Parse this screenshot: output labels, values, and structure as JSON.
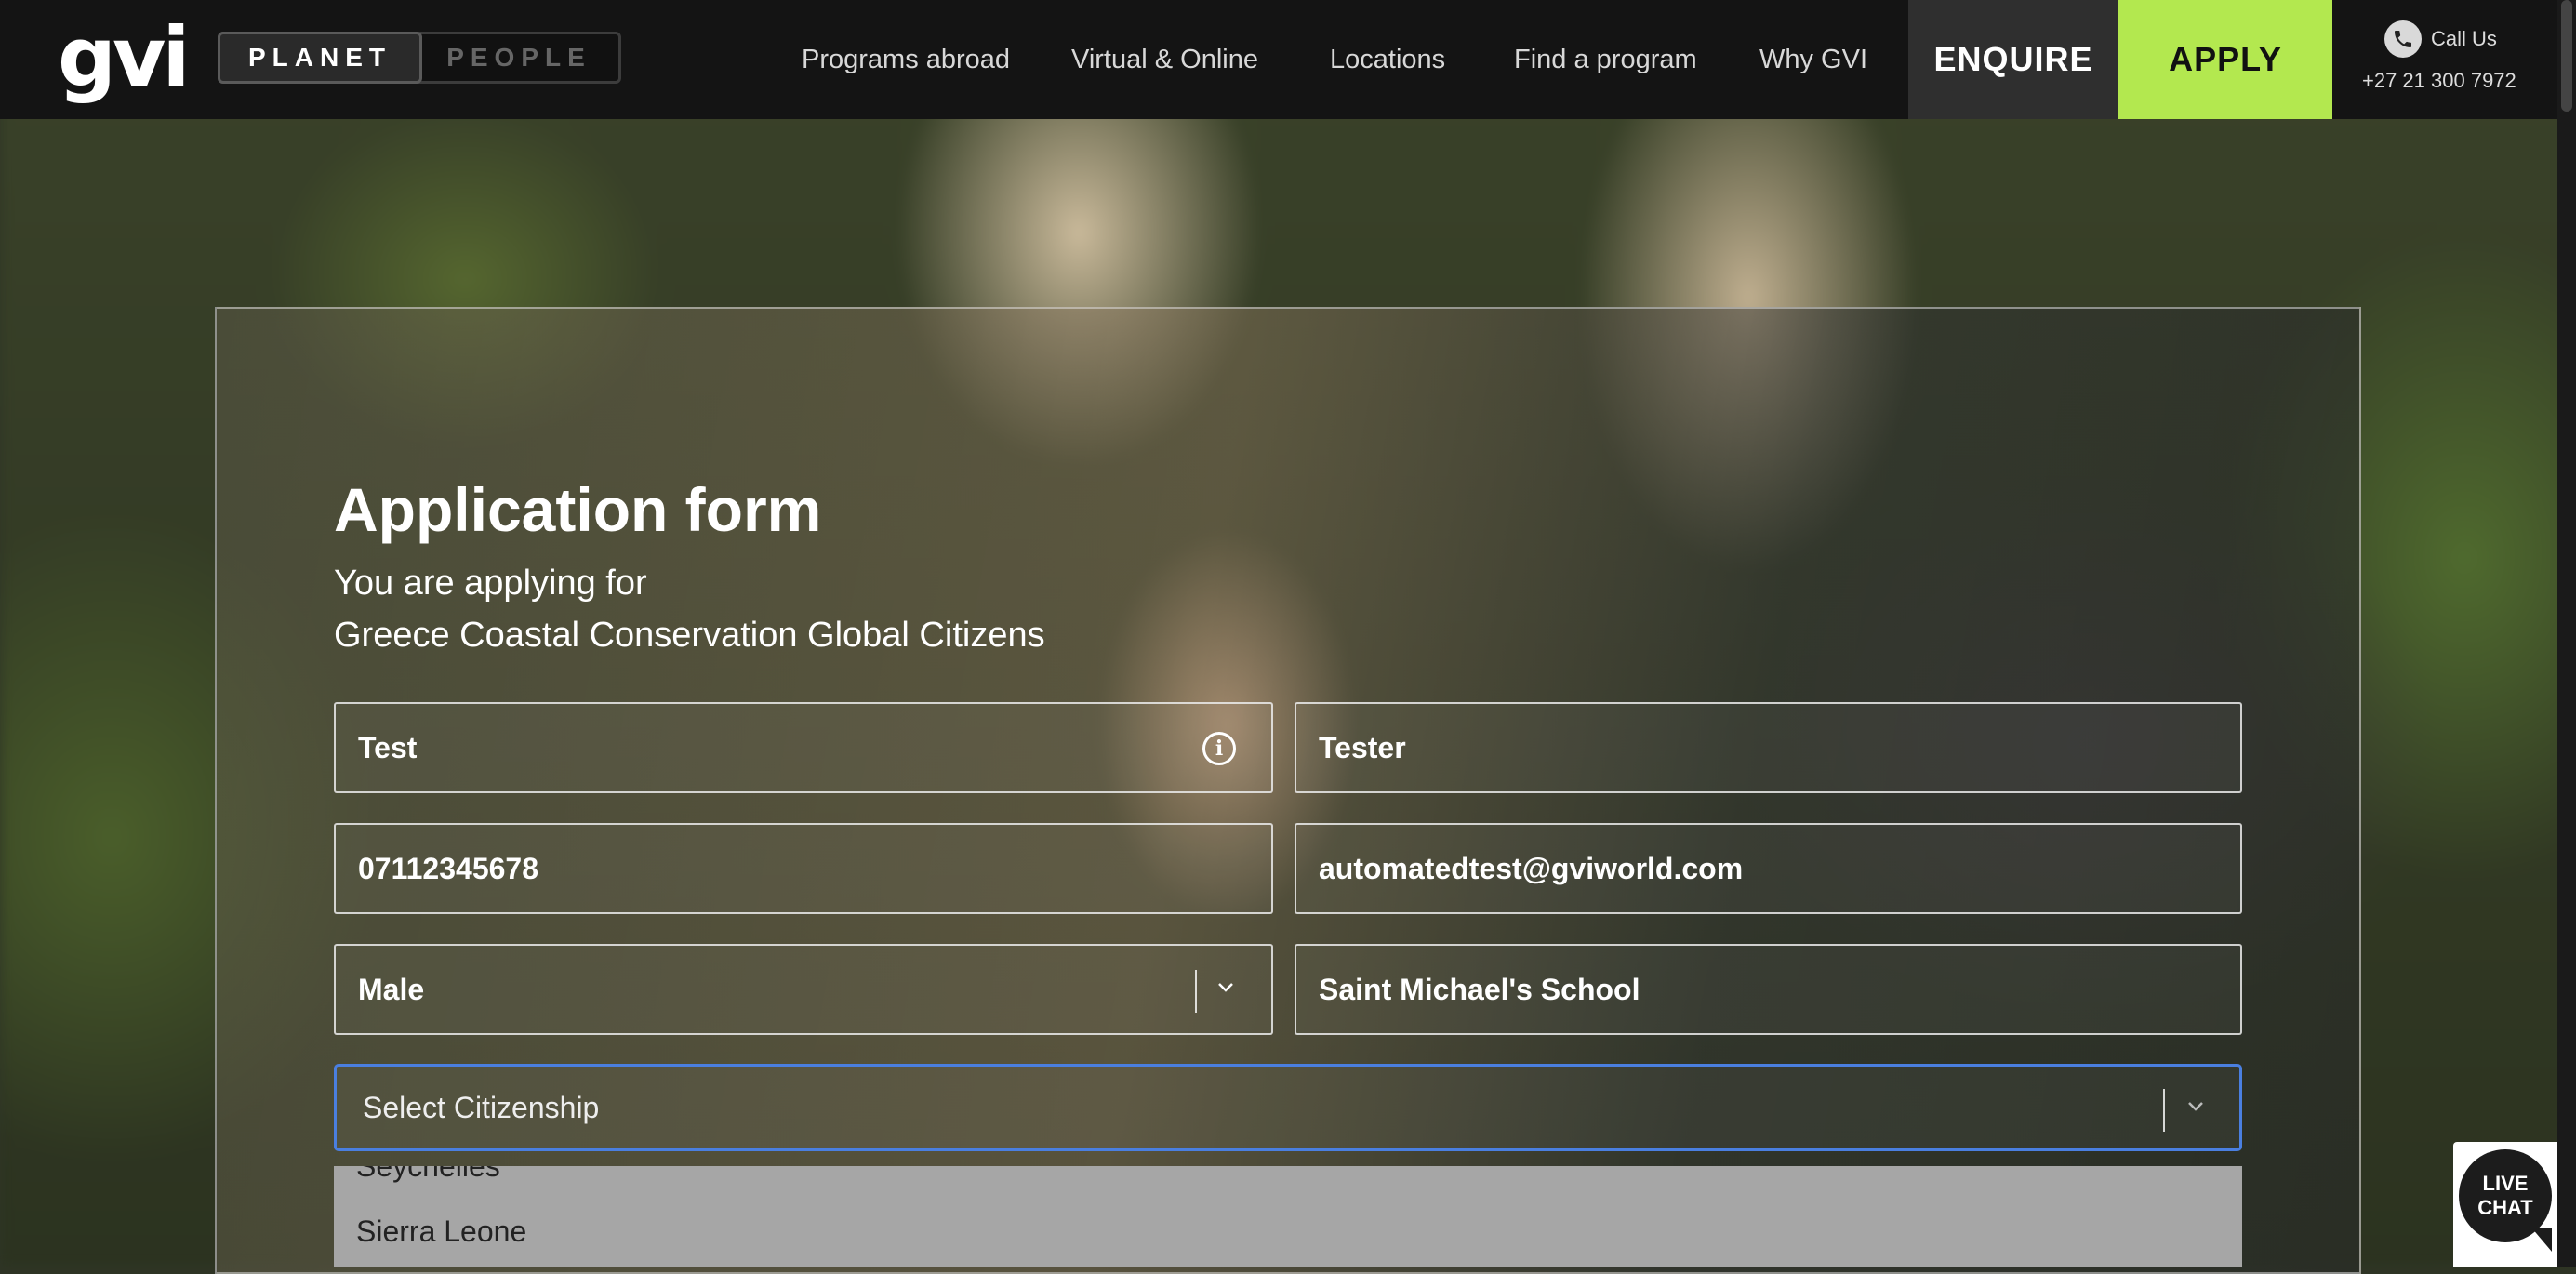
{
  "header": {
    "logo": "gvi",
    "toggle": [
      "PLANET",
      "PEOPLE"
    ],
    "toggle_active": "PLANET",
    "nav": [
      "Programs abroad",
      "Virtual & Online",
      "Locations",
      "Find a program",
      "Why GVI"
    ],
    "enquire": "ENQUIRE",
    "apply": "APPLY",
    "call_label": "Call Us",
    "phone": "+27 21 300 7972",
    "colors": {
      "bar": "#141414",
      "apply": "#b3e84f",
      "enquire": "#2f2f2f"
    }
  },
  "form": {
    "title": "Application form",
    "applying_for_label": "You are applying for",
    "program": "Greece Coastal Conservation Global Citizens",
    "first_name": "Test",
    "last_name": "Tester",
    "phone": "07112345678",
    "email": "automatedtest@gviworld.com",
    "gender": "Male",
    "school": "Saint Michael's School",
    "citizenship_placeholder": "Select Citizenship",
    "citizenship_options_visible": [
      "Seychelles",
      "Sierra Leone"
    ],
    "focus_color": "#4a7fe0"
  },
  "livechat": {
    "line1": "LIVE",
    "line2": "CHAT"
  },
  "icons": {
    "info": "info-icon",
    "chevron": "chevron-down-icon",
    "phone": "phone-icon"
  }
}
